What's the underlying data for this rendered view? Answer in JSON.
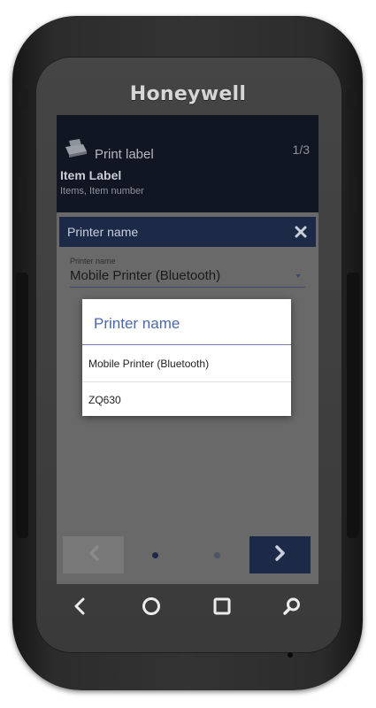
{
  "device": {
    "brand": "Honeywell"
  },
  "app_header": {
    "icon": "printer-icon",
    "title": "Print label",
    "step": "1/3",
    "item_title": "Item Label",
    "item_subtitle": "Items, Item number"
  },
  "panel": {
    "title": "Printer name",
    "close_icon": "close-icon",
    "field": {
      "label": "Printer name",
      "value": "Mobile Printer (Bluetooth)"
    }
  },
  "dialog": {
    "title": "Printer name",
    "options": [
      {
        "label": "Mobile Printer (Bluetooth)"
      },
      {
        "label": "ZQ630"
      }
    ]
  },
  "wizard_nav": {
    "prev_icon": "chevron-left-icon",
    "next_icon": "chevron-right-icon",
    "current_page": 1,
    "page_count": 2
  },
  "system_nav": {
    "icons": [
      "back-icon",
      "home-icon",
      "recent-apps-icon",
      "search-icon"
    ]
  },
  "colors": {
    "header_bg": "#111722",
    "accent_navy": "#1d2a47",
    "dialog_title": "#4a68a8",
    "screen_dim": "#696969"
  }
}
